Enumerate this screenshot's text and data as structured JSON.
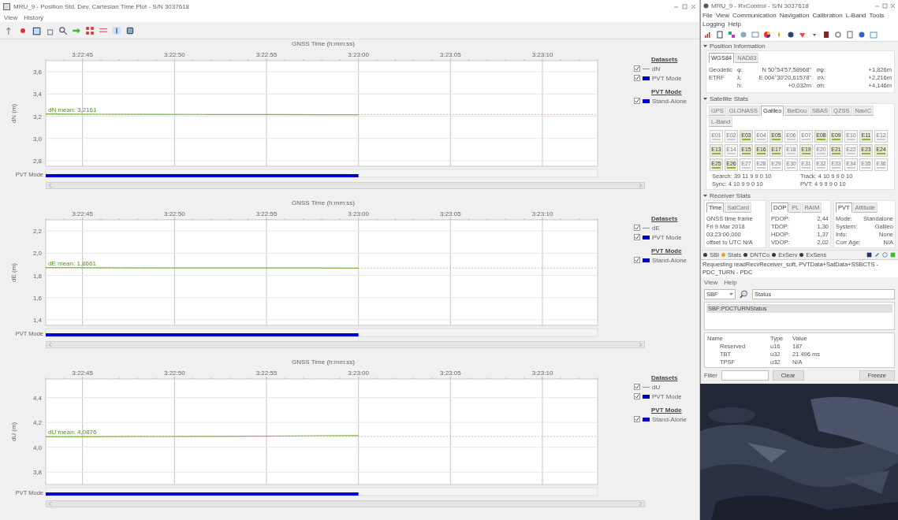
{
  "plot_window": {
    "title": "MRU_9 - Position Std. Dev. Cartesian Time Plot - S/N 3037618",
    "menu": [
      "View",
      "History"
    ],
    "charts": [
      {
        "chart_data": {
          "type": "line",
          "xlabel": "GNSS Time (h:mm:ss)",
          "ylabel": "dN (m)",
          "x": [
            12163,
            12166,
            12169,
            12172,
            12175,
            12178,
            12180
          ],
          "series": [
            {
              "name": "dN",
              "color": "#7cb342",
              "values": [
                3.22,
                3.218,
                3.217,
                3.216,
                3.216,
                3.213,
                3.214
              ]
            }
          ],
          "xlim": [
            12163,
            12193
          ],
          "ylim": [
            2.75,
            3.7
          ],
          "xticks": [
            {
              "value": 12165,
              "label": "3:22:45"
            },
            {
              "value": 12170,
              "label": "3:22:50"
            },
            {
              "value": 12175,
              "label": "3:22:55"
            },
            {
              "value": 12180,
              "label": "3:23:00"
            },
            {
              "value": 12185,
              "label": "3:23:05"
            },
            {
              "value": 12190,
              "label": "3:23:10"
            }
          ],
          "yticks": [
            {
              "value": 2.8,
              "label": "2,8"
            },
            {
              "value": 3.0,
              "label": "3,0"
            },
            {
              "value": 3.2,
              "label": "3,2"
            },
            {
              "value": 3.4,
              "label": "3,4"
            },
            {
              "value": 3.6,
              "label": "3,6"
            }
          ],
          "grid": true,
          "ref_lines": [
            {
              "axis": "y",
              "value": 3.2161,
              "label": "dN mean: 3,2161"
            }
          ]
        },
        "pvt_strip": {
          "label": "PVT Mode"
        },
        "legend": [
          {
            "title": "Datasets",
            "items": [
              {
                "kind": "series",
                "checked": true
              },
              {
                "label": "PVT Mode",
                "kind": "block",
                "color": "#0000cc",
                "checked": true
              }
            ]
          },
          {
            "title": "PVT Mode",
            "items": [
              {
                "label": "Stand-Alone",
                "kind": "block",
                "color": "#0000cc",
                "checked": true
              }
            ]
          }
        ]
      },
      {
        "chart_data": {
          "type": "line",
          "xlabel": "GNSS Time (h:mm:ss)",
          "ylabel": "dE (m)",
          "x": [
            12163,
            12166,
            12169,
            12172,
            12175,
            12178,
            12180
          ],
          "series": [
            {
              "name": "dE",
              "color": "#7cb342",
              "values": [
                1.87,
                1.868,
                1.867,
                1.866,
                1.866,
                1.866,
                1.865
              ]
            }
          ],
          "xlim": [
            12163,
            12193
          ],
          "ylim": [
            1.35,
            2.3
          ],
          "xticks": [
            {
              "value": 12165,
              "label": "3:22:45"
            },
            {
              "value": 12170,
              "label": "3:22:50"
            },
            {
              "value": 12175,
              "label": "3:22:55"
            },
            {
              "value": 12180,
              "label": "3:23:00"
            },
            {
              "value": 12185,
              "label": "3:23:05"
            },
            {
              "value": 12190,
              "label": "3:23:10"
            }
          ],
          "yticks": [
            {
              "value": 1.4,
              "label": "1,4"
            },
            {
              "value": 1.6,
              "label": "1,6"
            },
            {
              "value": 1.8,
              "label": "1,8"
            },
            {
              "value": 2.0,
              "label": "2,0"
            },
            {
              "value": 2.2,
              "label": "2,2"
            }
          ],
          "grid": true,
          "ref_lines": [
            {
              "axis": "y",
              "value": 1.8661,
              "label": "dE mean: 1,8661"
            }
          ]
        },
        "pvt_strip": {
          "label": "PVT Mode"
        },
        "legend": [
          {
            "title": "Datasets",
            "items": [
              {
                "kind": "series",
                "checked": true
              },
              {
                "label": "PVT Mode",
                "kind": "block",
                "color": "#0000cc",
                "checked": true
              }
            ]
          },
          {
            "title": "PVT Mode",
            "items": [
              {
                "label": "Stand-Alone",
                "kind": "block",
                "color": "#0000cc",
                "checked": true
              }
            ]
          }
        ]
      },
      {
        "chart_data": {
          "type": "line",
          "xlabel": "GNSS Time (h:mm:ss)",
          "ylabel": "dU (m)",
          "x": [
            12163,
            12166,
            12169,
            12172,
            12175,
            12178,
            12180
          ],
          "series": [
            {
              "name": "dU",
              "color": "#7cb342",
              "values": [
                4.085,
                4.086,
                4.087,
                4.088,
                4.09,
                4.093,
                4.094
              ]
            }
          ],
          "xlim": [
            12163,
            12193
          ],
          "ylim": [
            3.7,
            4.55
          ],
          "xticks": [
            {
              "value": 12165,
              "label": "3:22:45"
            },
            {
              "value": 12170,
              "label": "3:22:50"
            },
            {
              "value": 12175,
              "label": "3:22:55"
            },
            {
              "value": 12180,
              "label": "3:23:00"
            },
            {
              "value": 12185,
              "label": "3:23:05"
            },
            {
              "value": 12190,
              "label": "3:23:10"
            }
          ],
          "yticks": [
            {
              "value": 3.8,
              "label": "3,8"
            },
            {
              "value": 4.0,
              "label": "4,0"
            },
            {
              "value": 4.2,
              "label": "4,2"
            },
            {
              "value": 4.4,
              "label": "4,4"
            }
          ],
          "grid": true,
          "ref_lines": [
            {
              "axis": "y",
              "value": 4.0876,
              "label": "dU mean: 4,0876"
            }
          ]
        },
        "pvt_strip": {
          "label": "PVT Mode"
        },
        "legend": [
          {
            "title": "Datasets",
            "items": [
              {
                "kind": "series",
                "checked": true
              },
              {
                "label": "PVT Mode",
                "kind": "block",
                "color": "#0000cc",
                "checked": true
              }
            ]
          },
          {
            "title": "PVT Mode",
            "items": [
              {
                "label": "Stand-Alone",
                "kind": "block",
                "color": "#0000cc",
                "checked": true
              }
            ]
          }
        ]
      }
    ]
  },
  "rx_window": {
    "title": "MRU_9 - RxControl - S/N 3037618",
    "menu": [
      "File",
      "View",
      "Communication",
      "Navigation",
      "Calibration",
      "L-Band",
      "Tools",
      "Logging",
      "Help"
    ],
    "position": {
      "title": "Position Information",
      "tabs": [
        {
          "label": "WGS84",
          "selected": true
        },
        {
          "label": "NAD83",
          "selected": false
        }
      ],
      "rows": [
        {
          "frame": "Geodetic",
          "axis": "φ:",
          "value": "N 50°54'57,58968\"",
          "sigma_label": "σφ:",
          "sigma": "+1,826m"
        },
        {
          "frame": "ETRF",
          "axis": "λ:",
          "value": "E 004°30'20,61578\"",
          "sigma_label": "σλ:",
          "sigma": "+2,216m"
        },
        {
          "axis": "h:",
          "value": "+0,032m",
          "sigma_label": "σh:",
          "sigma": "+4,146m"
        }
      ]
    },
    "satellites": {
      "title": "Satellite Stats",
      "tabs": [
        {
          "label": "GPS",
          "selected": false
        },
        {
          "label": "GLONASS",
          "selected": false
        },
        {
          "label": "Galileo",
          "selected": true
        },
        {
          "label": "BeiDou",
          "selected": false
        },
        {
          "label": "SBAS",
          "selected": false
        },
        {
          "label": "QZSS",
          "selected": false
        },
        {
          "label": "NavIC",
          "selected": false
        },
        {
          "label": "L-Band",
          "selected": false
        }
      ],
      "sats": [
        {
          "label": "E01",
          "active": false
        },
        {
          "label": "E02",
          "active": false
        },
        {
          "label": "E03",
          "active": true
        },
        {
          "label": "E04",
          "active": false
        },
        {
          "label": "E05",
          "active": true
        },
        {
          "label": "E06",
          "active": false
        },
        {
          "label": "E07",
          "active": false
        },
        {
          "label": "E08",
          "active": true
        },
        {
          "label": "E09",
          "active": true
        },
        {
          "label": "E10",
          "active": false
        },
        {
          "label": "E11",
          "active": true
        },
        {
          "label": "E12",
          "active": false
        },
        {
          "label": "E13",
          "active": true
        },
        {
          "label": "E14",
          "active": false
        },
        {
          "label": "E15",
          "active": true
        },
        {
          "label": "E16",
          "active": true
        },
        {
          "label": "E17",
          "active": true
        },
        {
          "label": "E18",
          "active": false
        },
        {
          "label": "E19",
          "active": true
        },
        {
          "label": "E20",
          "active": false
        },
        {
          "label": "E21",
          "active": true
        },
        {
          "label": "E22",
          "active": false
        },
        {
          "label": "E23",
          "active": true
        },
        {
          "label": "E24",
          "active": true
        },
        {
          "label": "E25",
          "active": true
        },
        {
          "label": "E26",
          "active": true
        },
        {
          "label": "E27",
          "active": false
        },
        {
          "label": "E28",
          "active": false
        },
        {
          "label": "E29",
          "active": false
        },
        {
          "label": "E30",
          "active": false
        },
        {
          "label": "E31",
          "active": false
        },
        {
          "label": "E32",
          "active": false
        },
        {
          "label": "E33",
          "active": false
        },
        {
          "label": "E34",
          "active": false
        },
        {
          "label": "E35",
          "active": false
        },
        {
          "label": "E36",
          "active": false
        }
      ],
      "counts": [
        {
          "label": "Search:",
          "values": "39 11 9 9 0 10"
        },
        {
          "label": "Track:",
          "values": "4 10 9 9 0 10"
        },
        {
          "label": "Sync:",
          "values": "4 10 9 9 0 10"
        },
        {
          "label": "PVT:",
          "values": "4 9 9 9 0 10"
        }
      ]
    },
    "receiver": {
      "title": "Receiver Stats",
      "cards": [
        {
          "tabs": [
            {
              "label": "Time",
              "selected": true
            },
            {
              "label": "SatCard",
              "selected": false
            }
          ],
          "lines": [
            {
              "key": "GNSS time frame"
            },
            {
              "key": "Fri 9 Mar 2018"
            },
            {
              "key": "03:23:00,000"
            },
            {
              "key": "offset to UTC N/A"
            }
          ]
        },
        {
          "tabs": [
            {
              "label": "DOP",
              "selected": true
            },
            {
              "label": "PL",
              "selected": false
            },
            {
              "label": "RAIM",
              "selected": false
            }
          ],
          "lines": [
            {
              "key": "PDOP:",
              "value": "2,44"
            },
            {
              "key": "TDOP:",
              "value": "1,30"
            },
            {
              "key": "HDOP:",
              "value": "1,37"
            },
            {
              "key": "VDOP:",
              "value": "2,02"
            }
          ]
        },
        {
          "tabs": [
            {
              "label": "PVT",
              "selected": true
            },
            {
              "label": "Attitude",
              "selected": false
            }
          ],
          "lines": [
            {
              "key": "Mode:",
              "value": "Standalone"
            },
            {
              "key": "System:",
              "value": "Galileo"
            },
            {
              "key": "Info:",
              "value": "None"
            },
            {
              "key": "Corr Age:",
              "value": "N/A"
            }
          ]
        }
      ]
    },
    "status_items": [
      {
        "label": "SBI",
        "color": "#2f3b4a"
      },
      {
        "label": "Stats",
        "color": "#f0a020"
      },
      {
        "label": "DNTCo",
        "color": "#2f3b4a"
      },
      {
        "label": "ExServ",
        "color": "#2f3b4a"
      },
      {
        "label": "ExSens",
        "color": "#2f3b4a"
      }
    ],
    "status_message": "Requesting readRecvReceiver_soft, PVTData+SatData+SSBCTS - PDC_TURN - PDC"
  },
  "sbf_window": {
    "menu": [
      "View",
      "Help"
    ],
    "combo": "SBF",
    "search": {
      "value": "Status"
    },
    "blocks": [
      {
        "label": "SBF:PDCTURNStatus",
        "selected": true
      }
    ],
    "columns": [
      "Name",
      "Type",
      "Value"
    ],
    "rows": [
      {
        "name": "Reserved",
        "type": "u16",
        "value": "187"
      },
      {
        "name": "TBT",
        "type": "u32",
        "value": "21.496 ms"
      },
      {
        "name": "TPSF",
        "type": "u32",
        "value": "N/A"
      }
    ],
    "filter_label": "Filter",
    "clear_button": "Clear",
    "freeze_button": "Freeze"
  }
}
